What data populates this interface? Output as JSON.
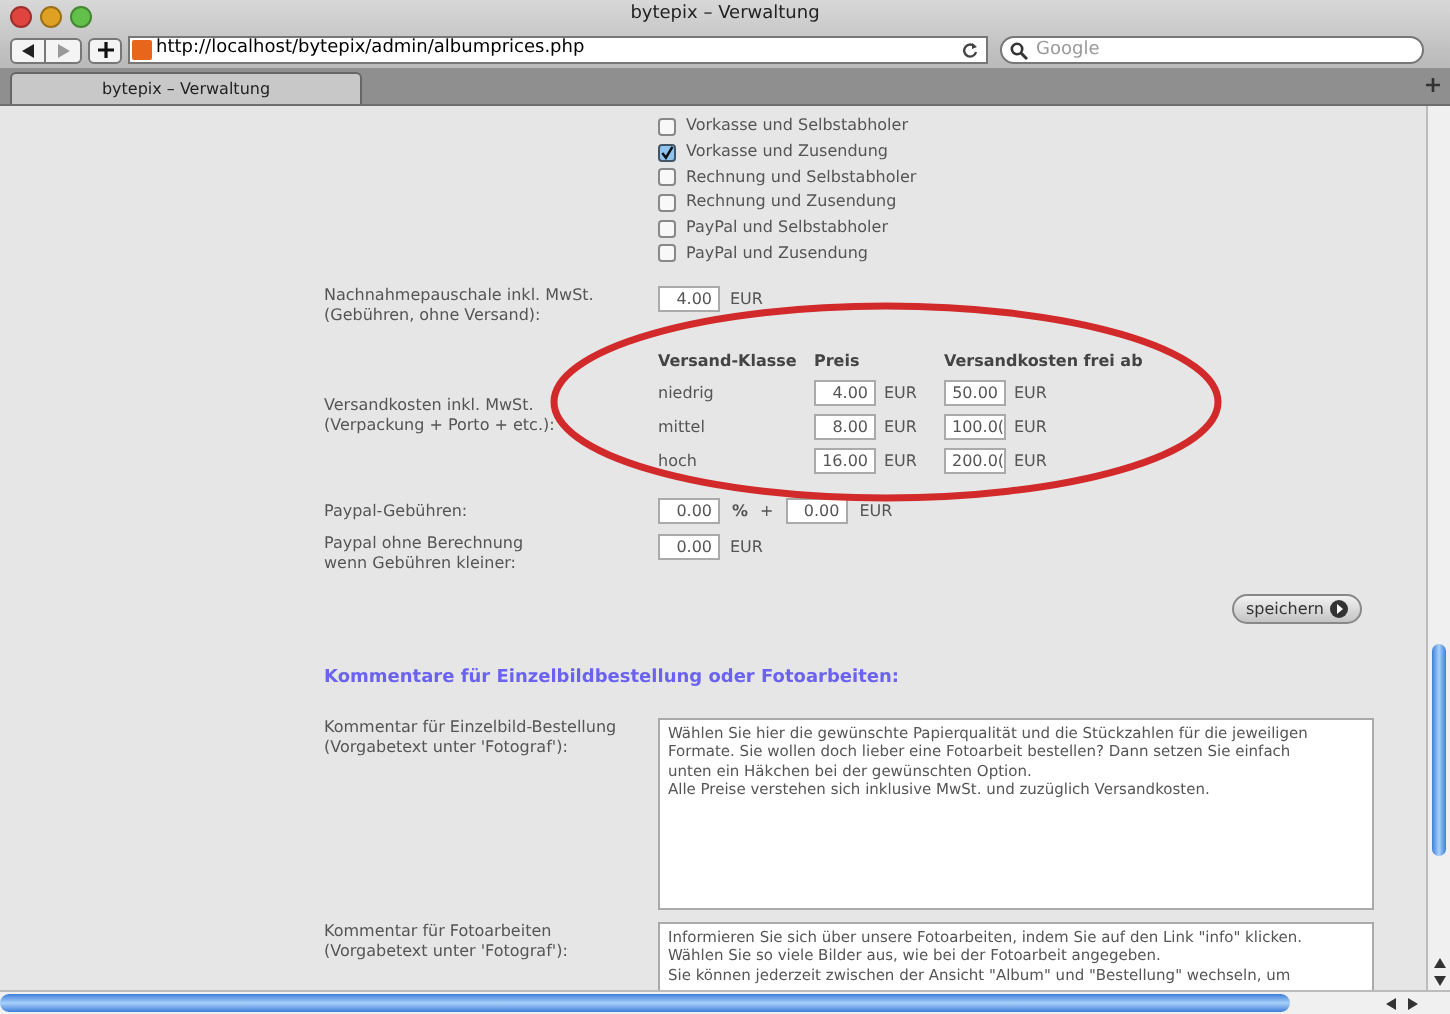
{
  "window": {
    "title": "bytepix – Verwaltung"
  },
  "toolbar": {
    "url": "http://localhost/bytepix/admin/albumprices.php",
    "search": {
      "placeholder": "Google"
    }
  },
  "tabs": [
    {
      "label": "bytepix – Verwaltung",
      "selected": true
    }
  ],
  "payment_options": [
    {
      "label": "Vorkasse und Selbstabholer",
      "checked": false
    },
    {
      "label": "Vorkasse und Zusendung",
      "checked": true
    },
    {
      "label": "Rechnung und Selbstabholer",
      "checked": false
    },
    {
      "label": "Rechnung und Zusendung",
      "checked": false
    },
    {
      "label": "PayPal und Selbstabholer",
      "checked": false
    },
    {
      "label": "PayPal und Zusendung",
      "checked": false
    }
  ],
  "cod_fee": {
    "label": "Nachnahmepauschale inkl. MwSt.\n(Gebühren, ohne Versand):",
    "value": "4.00",
    "unit": "EUR"
  },
  "shipping": {
    "label": "Versandkosten inkl. MwSt.\n(Verpackung + Porto + etc.):",
    "columns": [
      "Versand-Klasse",
      "Preis",
      "Versandkosten frei ab"
    ],
    "rows": [
      {
        "class": "niedrig",
        "price": "4.00",
        "price_unit": "EUR",
        "free_from": "50.00",
        "free_unit": "EUR"
      },
      {
        "class": "mittel",
        "price": "8.00",
        "price_unit": "EUR",
        "free_from": "100.0(",
        "free_unit": "EUR"
      },
      {
        "class": "hoch",
        "price": "16.00",
        "price_unit": "EUR",
        "free_from": "200.0(",
        "free_unit": "EUR"
      }
    ]
  },
  "paypal_fees": {
    "label": "Paypal-Gebühren:",
    "percent": "0.00",
    "percent_sign": "%",
    "plus": "+",
    "fixed": "0.00",
    "unit": "EUR"
  },
  "paypal_threshold": {
    "label": "Paypal ohne Berechnung\nwenn Gebühren kleiner:",
    "value": "0.00",
    "unit": "EUR"
  },
  "save_button": {
    "label": "speichern"
  },
  "comments": {
    "heading": "Kommentare für Einzelbildbestellung oder Fotoarbeiten:",
    "fields": [
      {
        "label": "Kommentar für Einzelbild-Bestellung\n(Vorgabetext unter 'Fotograf'):",
        "text": "Wählen Sie hier die gewünschte Papierqualität und die Stückzahlen für die jeweiligen\nFormate. Sie wollen doch lieber eine Fotoarbeit bestellen? Dann setzen Sie einfach\nunten ein Häkchen bei der gewünschten Option.\nAlle Preise verstehen sich inklusive MwSt. und zuzüglich Versandkosten."
      },
      {
        "label": "Kommentar für Fotoarbeiten\n(Vorgabetext unter 'Fotograf'):",
        "text": "Informieren Sie sich über unsere Fotoarbeiten, indem Sie auf den Link \"info\" klicken.\nWählen Sie so viele Bilder aus, wie bei der Fotoarbeit angegeben.\nSie können jederzeit zwischen der Ansicht \"Album\" und \"Bestellung\" wechseln, um"
      }
    ]
  }
}
